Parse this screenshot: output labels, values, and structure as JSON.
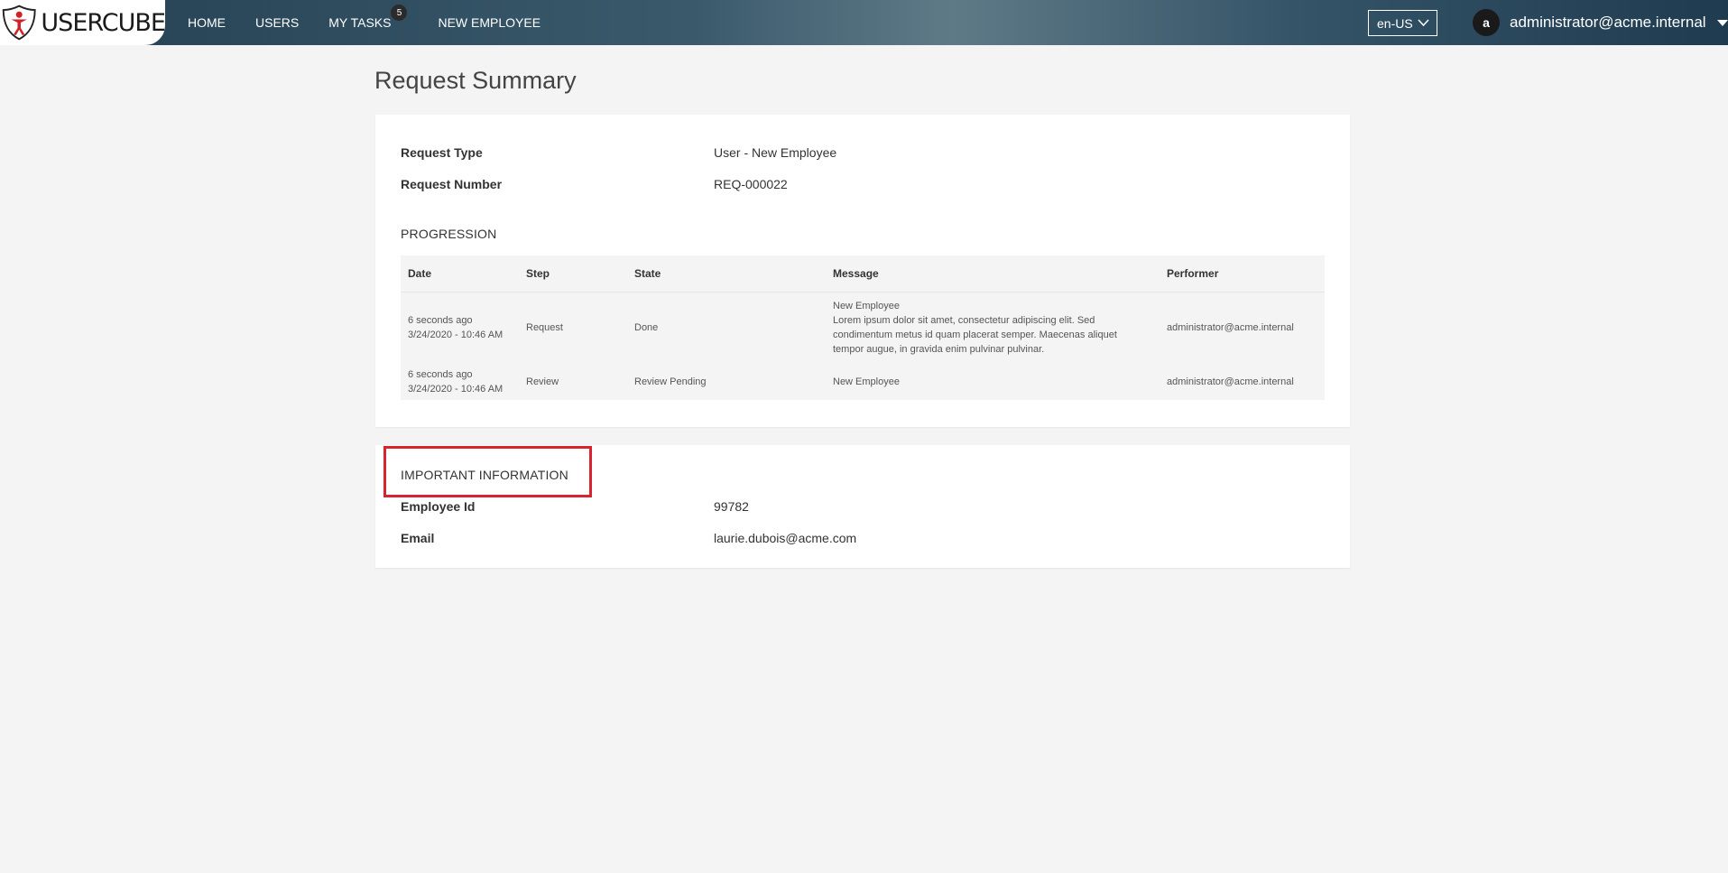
{
  "app": {
    "brand": "USERCUBE"
  },
  "nav": {
    "items": [
      {
        "label": "HOME"
      },
      {
        "label": "USERS"
      },
      {
        "label": "MY TASKS",
        "badge": "5"
      },
      {
        "label": "NEW EMPLOYEE"
      }
    ]
  },
  "language": {
    "selected": "en-US"
  },
  "user": {
    "avatar_letter": "a",
    "name": "administrator@acme.internal"
  },
  "page": {
    "title": "Request Summary"
  },
  "request": {
    "type_label": "Request Type",
    "type_value": "User - New Employee",
    "number_label": "Request Number",
    "number_value": "REQ-000022"
  },
  "progression": {
    "title": "PROGRESSION",
    "columns": [
      "Date",
      "Step",
      "State",
      "Message",
      "Performer"
    ],
    "rows": [
      {
        "date_relative": "6 seconds ago",
        "date_full": "3/24/2020 - 10:46 AM",
        "step": "Request",
        "state": "Done",
        "message_title": "New Employee",
        "message_body": "Lorem ipsum dolor sit amet, consectetur adipiscing elit. Sed condimentum metus id quam placerat semper. Maecenas aliquet tempor augue, in gravida enim pulvinar pulvinar.",
        "performer": "administrator@acme.internal"
      },
      {
        "date_relative": "6 seconds ago",
        "date_full": "3/24/2020 - 10:46 AM",
        "step": "Review",
        "state": "Review Pending",
        "message_title": "New Employee",
        "message_body": "",
        "performer": "administrator@acme.internal"
      }
    ]
  },
  "important": {
    "title": "IMPORTANT INFORMATION",
    "employee_id_label": "Employee Id",
    "employee_id_value": "99782",
    "email_label": "Email",
    "email_value": "laurie.dubois@acme.com"
  },
  "colors": {
    "highlight": "#d9232e",
    "brand_red": "#d32027",
    "nav_dark": "#243f52"
  }
}
